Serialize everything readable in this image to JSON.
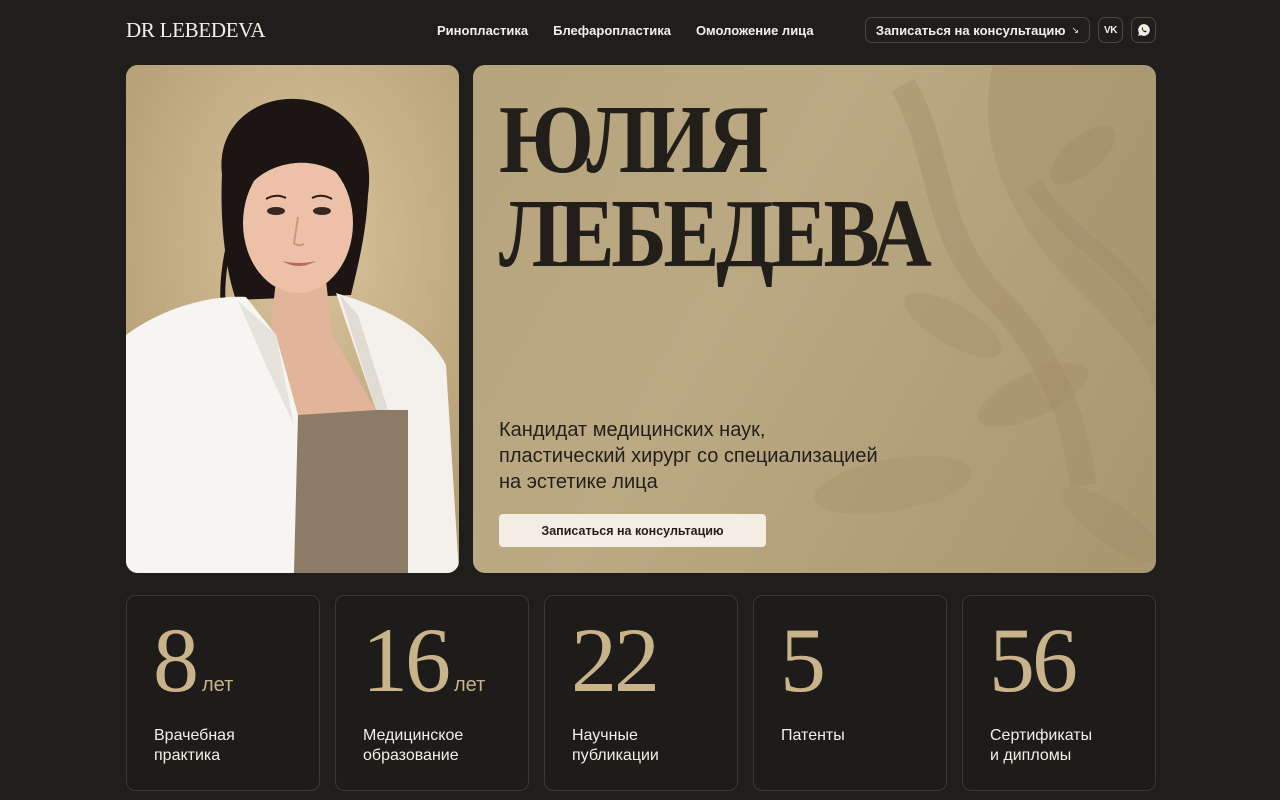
{
  "header": {
    "logo_dr": "DR",
    "logo_name": "LEBEDEVA",
    "nav": [
      "Ринопластика",
      "Блефаропластика",
      "Омоложение лица"
    ],
    "cta": "Записаться на консультацию",
    "cta_arrow": "↘",
    "vk": "VK"
  },
  "hero": {
    "title_line1": "ЮЛИЯ",
    "title_line2": "ЛЕБЕДЕВА",
    "subtitle_line1": "Кандидат медицинских наук,",
    "subtitle_line2": "пластический хирург со специализацией",
    "subtitle_line3": "на эстетике лица",
    "cta": "Записаться на консультацию"
  },
  "stats": [
    {
      "value": "8",
      "unit": "лет",
      "label_line1": "Врачебная",
      "label_line2": "практика"
    },
    {
      "value": "16",
      "unit": "лет",
      "label_line1": "Медицинское",
      "label_line2": "образование"
    },
    {
      "value": "22",
      "unit": "",
      "label_line1": "Научные",
      "label_line2": "публикации"
    },
    {
      "value": "5",
      "unit": "",
      "label_line1": "Патенты",
      "label_line2": ""
    },
    {
      "value": "56",
      "unit": "",
      "label_line1": "Сертификаты",
      "label_line2": "и дипломы"
    }
  ],
  "colors": {
    "background": "#201e1c",
    "accent_gold": "#c8b38b",
    "hero_card": "#b5a47c",
    "button_light": "#f3ede4"
  }
}
